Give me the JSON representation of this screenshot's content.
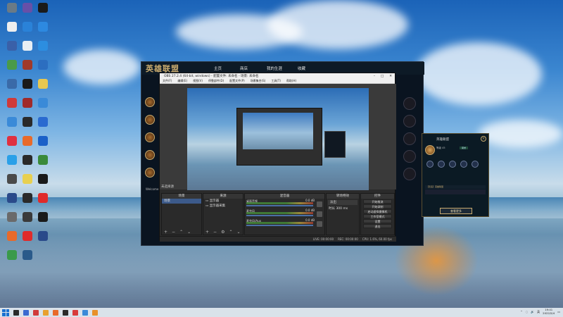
{
  "desktop": {
    "icons": [
      {
        "label": "",
        "color": "#6a7a86"
      },
      {
        "label": "",
        "color": "#6750a8"
      },
      {
        "label": "",
        "color": "#1a1a1a"
      },
      {
        "label": "",
        "color": "#eeeeee"
      },
      {
        "label": "",
        "color": "#2a82d8"
      },
      {
        "label": "",
        "color": "#2d89e0"
      },
      {
        "label": "",
        "color": "#3a60a8"
      },
      {
        "label": "",
        "color": "#e8eef4"
      },
      {
        "label": "",
        "color": "#2c8ee0"
      },
      {
        "label": "",
        "color": "#4a9a4a"
      },
      {
        "label": "",
        "color": "#a03a2a"
      },
      {
        "label": "",
        "color": "#2c6ec0"
      },
      {
        "label": "",
        "color": "#3a6aa8"
      },
      {
        "label": "",
        "color": "#1a1a1a"
      },
      {
        "label": "",
        "color": "#e8c850"
      },
      {
        "label": "",
        "color": "#d03a3a"
      },
      {
        "label": "",
        "color": "#a02a2a"
      },
      {
        "label": "",
        "color": "#3a8ad8"
      },
      {
        "label": "",
        "color": "#3a8ad8"
      },
      {
        "label": "",
        "color": "#2a2a2a"
      },
      {
        "label": "",
        "color": "#2a6ad0"
      },
      {
        "label": "",
        "color": "#e03040"
      },
      {
        "label": "",
        "color": "#e86a2a"
      },
      {
        "label": "",
        "color": "#1a60c8"
      },
      {
        "label": "",
        "color": "#2aa0e8"
      },
      {
        "label": "",
        "color": "#2a2a2a"
      },
      {
        "label": "",
        "color": "#3a8a3a"
      },
      {
        "label": "",
        "color": "#4a4a4a"
      },
      {
        "label": "",
        "color": "#e8d050"
      },
      {
        "label": "",
        "color": "#1a1a1a"
      },
      {
        "label": "",
        "color": "#2a4a8a"
      },
      {
        "label": "",
        "color": "#2a2a2a"
      },
      {
        "label": "",
        "color": "#e02a2a"
      },
      {
        "label": "",
        "color": "#6a6a6a"
      },
      {
        "label": "",
        "color": "#3a3a3a"
      },
      {
        "label": "",
        "color": "#1a1a1a"
      },
      {
        "label": "",
        "color": "#e86a2a"
      },
      {
        "label": "",
        "color": "#e02a2a"
      },
      {
        "label": "",
        "color": "#2a4a8a"
      },
      {
        "label": "",
        "color": "#3a9a4a"
      },
      {
        "label": "",
        "color": "#2a5a8a"
      }
    ]
  },
  "lol_client": {
    "logo": "英雄联盟",
    "nav": {
      "home": "主页",
      "store": "商店",
      "career": "我的生涯",
      "collection": "收藏"
    },
    "side_text": "Welcome"
  },
  "obs": {
    "title": "OBS 27.2.4 (64-bit, windows) - 配置文件: 未命名 - 场景: 未命名",
    "menu": [
      "文件(F)",
      "编辑(E)",
      "视图(V)",
      "停靠部件(D)",
      "配置文件(P)",
      "场景集合(S)",
      "工具(T)",
      "帮助(H)"
    ],
    "sources_label": "未选择源",
    "docks": {
      "scenes": {
        "title": "场景",
        "items": [
          "场景"
        ]
      },
      "sources": {
        "title": "来源",
        "items": [
          "显示器",
          "显示器采集"
        ]
      },
      "mixer": {
        "title": "混音器",
        "tracks": [
          {
            "name": "桌面音频",
            "db": "0.0 dB"
          },
          {
            "name": "麦克风",
            "db": "0.0 dB"
          },
          {
            "name": "麦克风/Aux",
            "db": "0.0 dB"
          }
        ]
      },
      "transitions": {
        "title": "转场特效",
        "type": "淡出",
        "duration_label": "时长",
        "duration": "300 ms"
      },
      "controls": {
        "title": "控件",
        "buttons": [
          "开始推流",
          "开始录制",
          "启动虚拟摄像机",
          "工作室模式",
          "设置",
          "退出"
        ]
      }
    },
    "status": [
      "LIVE: 00:00:00",
      "REC: 00:00:00",
      "CPU: 1.6%, 60.00 fps"
    ]
  },
  "lol_profile": {
    "name": "英雄联盟",
    "sub": "等级 45",
    "badge": "荣誉",
    "bar_text": "【无名】英雄联盟",
    "confirm": "查看更多",
    "close": "×"
  },
  "taskbar": {
    "apps": [
      "#2a2a2a",
      "#3a6ad0",
      "#d03a3a",
      "#e8a030",
      "#e86a2a",
      "#2a2a2a",
      "#d83a3a",
      "#3a8ad8",
      "#e8902a"
    ],
    "tray": {
      "lang": "英",
      "clock_time": "19:41",
      "clock_date": "2022/5/4"
    }
  }
}
